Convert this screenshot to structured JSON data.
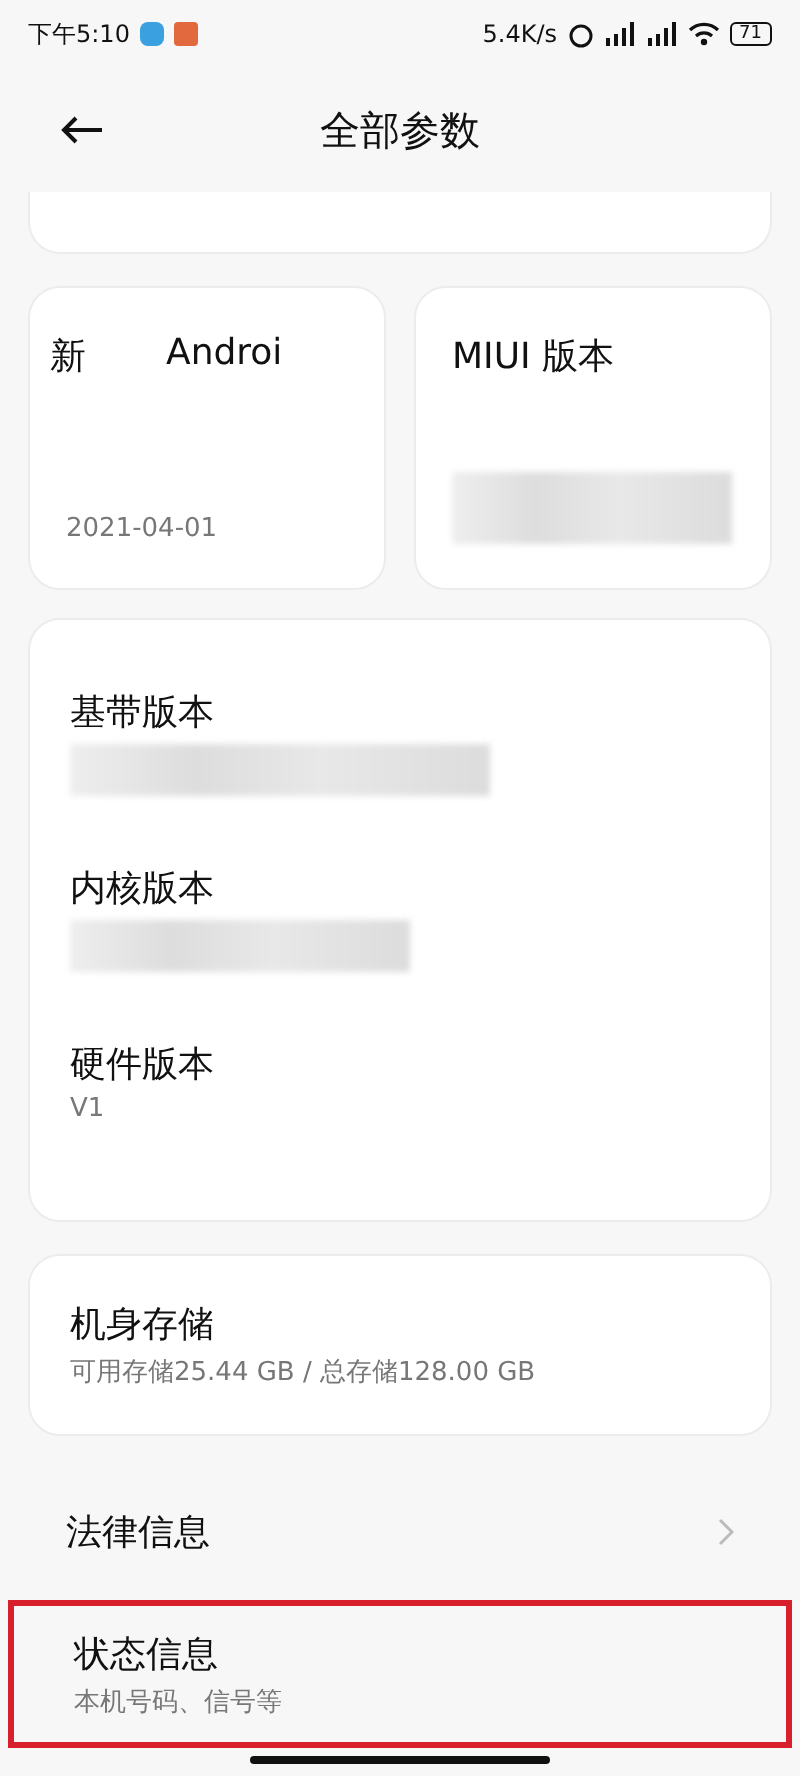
{
  "status_bar": {
    "time": "下午5:10",
    "speed": "5.4K/s",
    "battery": "71"
  },
  "header": {
    "title": "全部参数"
  },
  "tiles": [
    {
      "marquee": [
        "新",
        "Androi"
      ],
      "value": "2021-04-01",
      "redacted": false
    },
    {
      "title": "MIUI 版本",
      "redacted": true
    }
  ],
  "versions": [
    {
      "label": "基带版本",
      "redacted": true
    },
    {
      "label": "内核版本",
      "redacted": true
    },
    {
      "label": "硬件版本",
      "value": "V1",
      "redacted": false
    }
  ],
  "storage": {
    "label": "机身存储",
    "value": "可用存储25.44 GB / 总存储128.00 GB"
  },
  "menu": [
    {
      "label": "法律信息",
      "chevron": true,
      "highlighted": false
    },
    {
      "label": "状态信息",
      "subtitle": "本机号码、信号等",
      "chevron": false,
      "highlighted": true
    }
  ]
}
